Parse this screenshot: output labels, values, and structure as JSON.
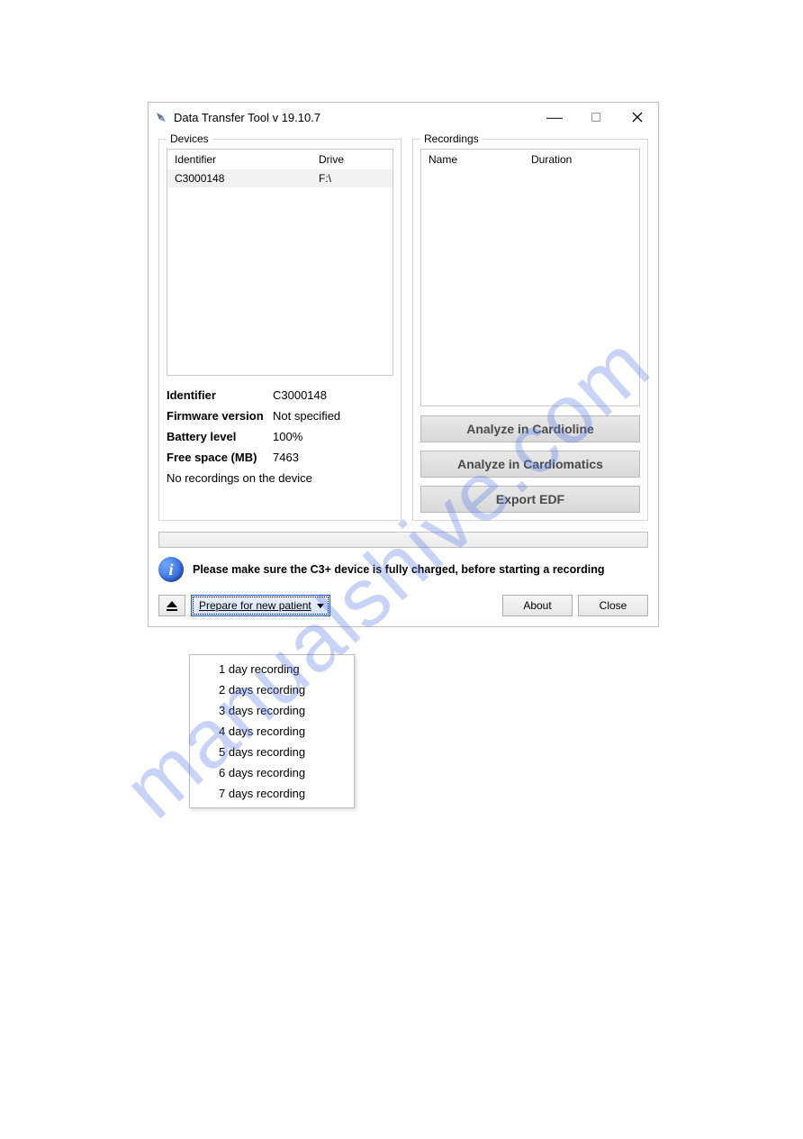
{
  "window": {
    "title": "Data Transfer Tool v 19.10.7"
  },
  "devices": {
    "legend": "Devices",
    "columns": {
      "identifier": "Identifier",
      "drive": "Drive"
    },
    "rows": [
      {
        "identifier": "C3000148",
        "drive": "F:\\"
      }
    ],
    "details": {
      "identifier_label": "Identifier",
      "identifier_value": "C3000148",
      "firmware_label": "Firmware version",
      "firmware_value": "Not specified",
      "battery_label": "Battery level",
      "battery_value": "100%",
      "freespace_label": "Free space (MB)",
      "freespace_value": "7463",
      "status": "No recordings on the device"
    }
  },
  "recordings": {
    "legend": "Recordings",
    "columns": {
      "name": "Name",
      "duration": "Duration"
    },
    "buttons": {
      "cardioline": "Analyze in Cardioline",
      "cardiomatics": "Analyze in Cardiomatics",
      "export_edf": "Export EDF"
    }
  },
  "info": {
    "text": "Please make sure the C3+ device is fully charged, before starting a recording"
  },
  "footer": {
    "prepare_label": "Prepare for new patient",
    "about": "About",
    "close": "Close"
  },
  "menu": {
    "items": [
      "1 day recording",
      "2 days recording",
      "3 days recording",
      "4 days recording",
      "5 days recording",
      "6 days recording",
      "7 days recording"
    ]
  },
  "watermark": "manualshive.com"
}
